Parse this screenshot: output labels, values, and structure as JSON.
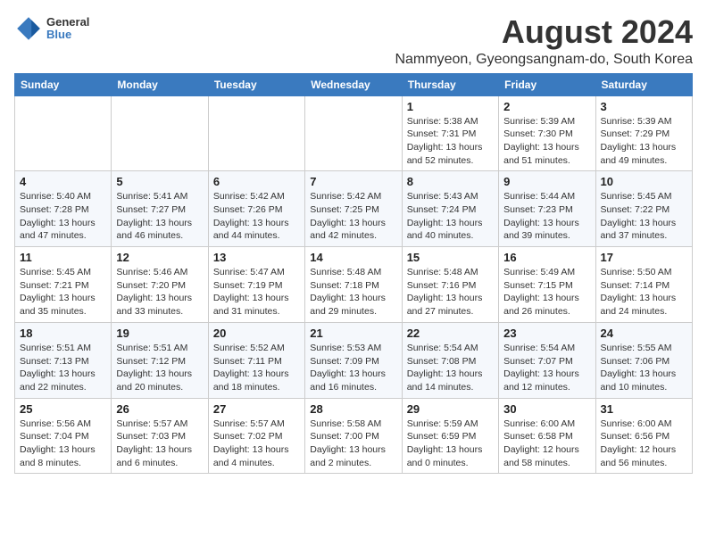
{
  "logo": {
    "general": "General",
    "blue": "Blue"
  },
  "title": "August 2024",
  "subtitle": "Nammyeon, Gyeongsangnam-do, South Korea",
  "days_of_week": [
    "Sunday",
    "Monday",
    "Tuesday",
    "Wednesday",
    "Thursday",
    "Friday",
    "Saturday"
  ],
  "weeks": [
    [
      {
        "day": "",
        "info": ""
      },
      {
        "day": "",
        "info": ""
      },
      {
        "day": "",
        "info": ""
      },
      {
        "day": "",
        "info": ""
      },
      {
        "day": "1",
        "info": "Sunrise: 5:38 AM\nSunset: 7:31 PM\nDaylight: 13 hours\nand 52 minutes."
      },
      {
        "day": "2",
        "info": "Sunrise: 5:39 AM\nSunset: 7:30 PM\nDaylight: 13 hours\nand 51 minutes."
      },
      {
        "day": "3",
        "info": "Sunrise: 5:39 AM\nSunset: 7:29 PM\nDaylight: 13 hours\nand 49 minutes."
      }
    ],
    [
      {
        "day": "4",
        "info": "Sunrise: 5:40 AM\nSunset: 7:28 PM\nDaylight: 13 hours\nand 47 minutes."
      },
      {
        "day": "5",
        "info": "Sunrise: 5:41 AM\nSunset: 7:27 PM\nDaylight: 13 hours\nand 46 minutes."
      },
      {
        "day": "6",
        "info": "Sunrise: 5:42 AM\nSunset: 7:26 PM\nDaylight: 13 hours\nand 44 minutes."
      },
      {
        "day": "7",
        "info": "Sunrise: 5:42 AM\nSunset: 7:25 PM\nDaylight: 13 hours\nand 42 minutes."
      },
      {
        "day": "8",
        "info": "Sunrise: 5:43 AM\nSunset: 7:24 PM\nDaylight: 13 hours\nand 40 minutes."
      },
      {
        "day": "9",
        "info": "Sunrise: 5:44 AM\nSunset: 7:23 PM\nDaylight: 13 hours\nand 39 minutes."
      },
      {
        "day": "10",
        "info": "Sunrise: 5:45 AM\nSunset: 7:22 PM\nDaylight: 13 hours\nand 37 minutes."
      }
    ],
    [
      {
        "day": "11",
        "info": "Sunrise: 5:45 AM\nSunset: 7:21 PM\nDaylight: 13 hours\nand 35 minutes."
      },
      {
        "day": "12",
        "info": "Sunrise: 5:46 AM\nSunset: 7:20 PM\nDaylight: 13 hours\nand 33 minutes."
      },
      {
        "day": "13",
        "info": "Sunrise: 5:47 AM\nSunset: 7:19 PM\nDaylight: 13 hours\nand 31 minutes."
      },
      {
        "day": "14",
        "info": "Sunrise: 5:48 AM\nSunset: 7:18 PM\nDaylight: 13 hours\nand 29 minutes."
      },
      {
        "day": "15",
        "info": "Sunrise: 5:48 AM\nSunset: 7:16 PM\nDaylight: 13 hours\nand 27 minutes."
      },
      {
        "day": "16",
        "info": "Sunrise: 5:49 AM\nSunset: 7:15 PM\nDaylight: 13 hours\nand 26 minutes."
      },
      {
        "day": "17",
        "info": "Sunrise: 5:50 AM\nSunset: 7:14 PM\nDaylight: 13 hours\nand 24 minutes."
      }
    ],
    [
      {
        "day": "18",
        "info": "Sunrise: 5:51 AM\nSunset: 7:13 PM\nDaylight: 13 hours\nand 22 minutes."
      },
      {
        "day": "19",
        "info": "Sunrise: 5:51 AM\nSunset: 7:12 PM\nDaylight: 13 hours\nand 20 minutes."
      },
      {
        "day": "20",
        "info": "Sunrise: 5:52 AM\nSunset: 7:11 PM\nDaylight: 13 hours\nand 18 minutes."
      },
      {
        "day": "21",
        "info": "Sunrise: 5:53 AM\nSunset: 7:09 PM\nDaylight: 13 hours\nand 16 minutes."
      },
      {
        "day": "22",
        "info": "Sunrise: 5:54 AM\nSunset: 7:08 PM\nDaylight: 13 hours\nand 14 minutes."
      },
      {
        "day": "23",
        "info": "Sunrise: 5:54 AM\nSunset: 7:07 PM\nDaylight: 13 hours\nand 12 minutes."
      },
      {
        "day": "24",
        "info": "Sunrise: 5:55 AM\nSunset: 7:06 PM\nDaylight: 13 hours\nand 10 minutes."
      }
    ],
    [
      {
        "day": "25",
        "info": "Sunrise: 5:56 AM\nSunset: 7:04 PM\nDaylight: 13 hours\nand 8 minutes."
      },
      {
        "day": "26",
        "info": "Sunrise: 5:57 AM\nSunset: 7:03 PM\nDaylight: 13 hours\nand 6 minutes."
      },
      {
        "day": "27",
        "info": "Sunrise: 5:57 AM\nSunset: 7:02 PM\nDaylight: 13 hours\nand 4 minutes."
      },
      {
        "day": "28",
        "info": "Sunrise: 5:58 AM\nSunset: 7:00 PM\nDaylight: 13 hours\nand 2 minutes."
      },
      {
        "day": "29",
        "info": "Sunrise: 5:59 AM\nSunset: 6:59 PM\nDaylight: 13 hours\nand 0 minutes."
      },
      {
        "day": "30",
        "info": "Sunrise: 6:00 AM\nSunset: 6:58 PM\nDaylight: 12 hours\nand 58 minutes."
      },
      {
        "day": "31",
        "info": "Sunrise: 6:00 AM\nSunset: 6:56 PM\nDaylight: 12 hours\nand 56 minutes."
      }
    ]
  ]
}
